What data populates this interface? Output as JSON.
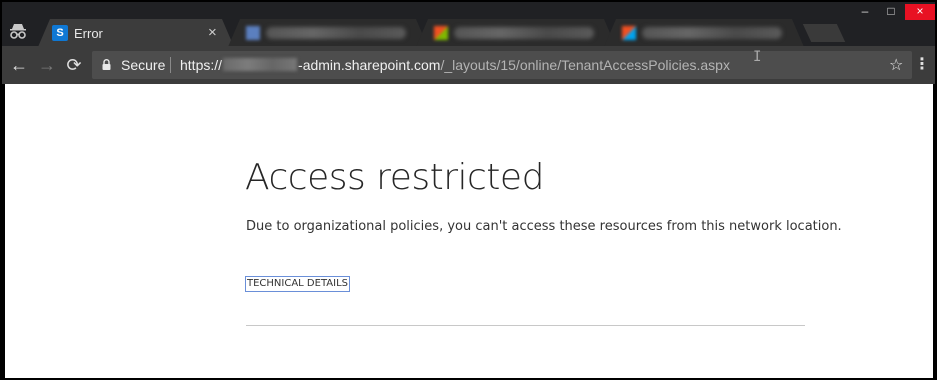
{
  "browser": {
    "active_tab": {
      "title": "Error",
      "favicon": "sharepoint-icon",
      "close_glyph": "×"
    },
    "toolbar": {
      "back_glyph": "←",
      "forward_glyph": "→",
      "reload_glyph": "⟳",
      "security_label": "Secure",
      "url_prefix": "https://",
      "url_host": "-admin.sharepoint.com",
      "url_path": "/_layouts/15/online/TenantAccessPolicies.aspx",
      "star_glyph": "☆",
      "menu_glyph": "⋮"
    },
    "window_controls": {
      "minimize": "–",
      "maximize": "□",
      "close": "×"
    }
  },
  "page": {
    "title": "Access restricted",
    "message": "Due to organizational policies, you can't access these resources from this network location.",
    "details_label": "TECHNICAL DETAILS"
  },
  "colors": {
    "accent": "#0f78d4",
    "close_red": "#e81123",
    "link_border": "#6a8fd8"
  }
}
